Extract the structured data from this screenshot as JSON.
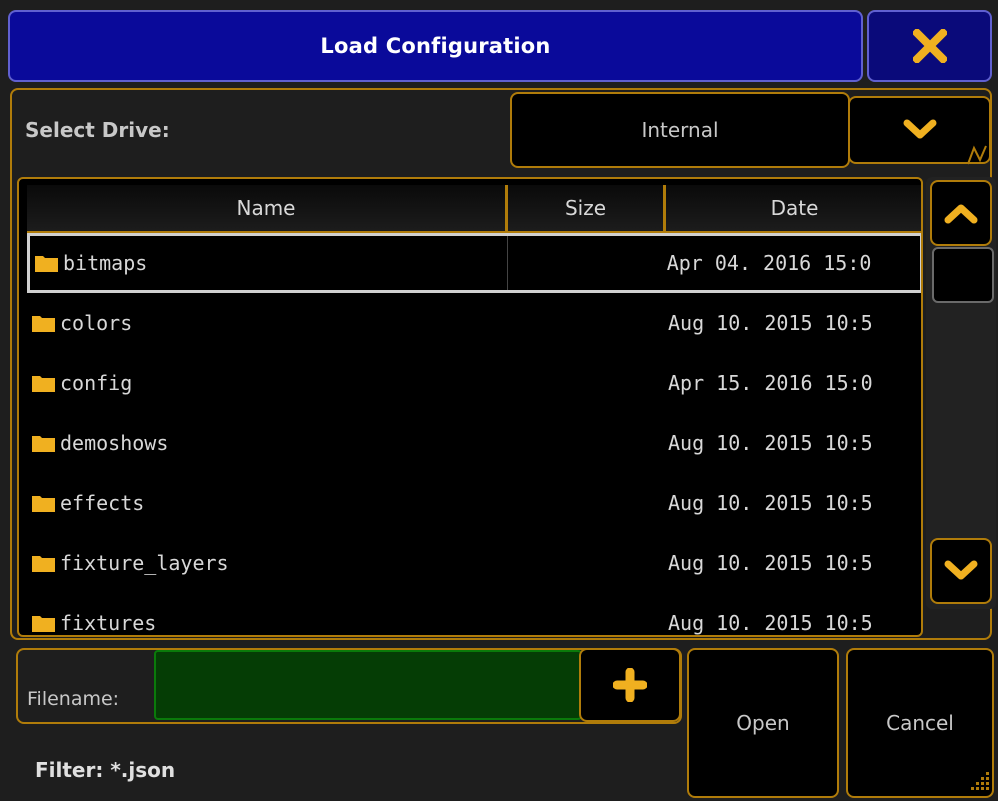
{
  "dialog": {
    "title": "Load Configuration",
    "close_icon": "close-x-icon"
  },
  "drive": {
    "label": "Select Drive:",
    "value": "Internal",
    "dropdown_icon": "chevron-down-icon"
  },
  "table": {
    "columns": [
      "Name",
      "Size",
      "Date"
    ],
    "rows": [
      {
        "name": "bitmaps",
        "size": "",
        "date": "Apr 04. 2016 15:0",
        "selected": true
      },
      {
        "name": "colors",
        "size": "",
        "date": "Aug 10. 2015 10:5"
      },
      {
        "name": "config",
        "size": "",
        "date": "Apr 15. 2016 15:0"
      },
      {
        "name": "demoshows",
        "size": "",
        "date": "Aug 10. 2015 10:5"
      },
      {
        "name": "effects",
        "size": "",
        "date": "Aug 10. 2015 10:5"
      },
      {
        "name": "fixture_layers",
        "size": "",
        "date": "Aug 10. 2015 10:5"
      },
      {
        "name": "fixtures",
        "size": "",
        "date": "Aug 10. 2015 10:5"
      }
    ]
  },
  "scrollbar": {
    "up_icon": "chevron-up-icon",
    "down_icon": "chevron-down-icon"
  },
  "footer": {
    "filename_label": "Filename:",
    "filename_value": "",
    "add_icon": "plus-icon",
    "filter": "Filter: *.json",
    "open_label": "Open",
    "cancel_label": "Cancel"
  },
  "colors": {
    "accent": "#b07c0a",
    "icon": "#f0b020",
    "title_bg": "#0a0a9a",
    "input_bg": "#053d05"
  }
}
